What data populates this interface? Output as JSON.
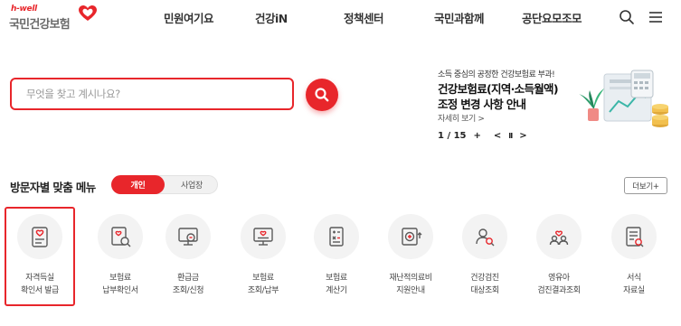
{
  "logo": {
    "brand_en": "h-well",
    "brand_ko": "국민건강보험"
  },
  "nav": [
    "민원여기요",
    "건강iN",
    "정책센터",
    "국민과함께",
    "공단요모조모"
  ],
  "header_icons": [
    "search-icon",
    "hamburger-menu-icon"
  ],
  "search": {
    "placeholder": "무엇을 찾고 계시나요?",
    "value": ""
  },
  "banner": {
    "subtitle": "소득 중심의 공정한 건강보험료 부과!",
    "title_line1": "건강보험료(지역·소득월액)",
    "title_line2": "조정 변경 사항 안내",
    "more": "자세히 보기 >",
    "pager": "1 / 15",
    "plus": "+",
    "prev": "<",
    "pause": "II",
    "next": ">"
  },
  "section": {
    "title": "방문자별 맞춤 메뉴",
    "toggle": {
      "active": "개인",
      "inactive": "사업장"
    },
    "more": "더보기+"
  },
  "menu_items": [
    {
      "line1": "자격득실",
      "line2": "확인서 발급",
      "icon": "id-card-heart-icon",
      "selected": true
    },
    {
      "line1": "보험료",
      "line2": "납부확인서",
      "icon": "document-search-icon",
      "selected": false
    },
    {
      "line1": "환급금",
      "line2": "조회/신청",
      "icon": "monitor-coin-icon",
      "selected": false
    },
    {
      "line1": "보험료",
      "line2": "조회/납부",
      "icon": "monitor-pay-icon",
      "selected": false
    },
    {
      "line1": "보험료",
      "line2": "계산기",
      "icon": "calculator-icon",
      "selected": false
    },
    {
      "line1": "재난적의료비",
      "line2": "지원안내",
      "icon": "medical-support-icon",
      "selected": false
    },
    {
      "line1": "건강검진",
      "line2": "대상조회",
      "icon": "user-search-icon",
      "selected": false
    },
    {
      "line1": "영유아",
      "line2": "검진결과조회",
      "icon": "family-heart-icon",
      "selected": false
    },
    {
      "line1": "서식",
      "line2": "자료실",
      "icon": "form-document-icon",
      "selected": false
    }
  ],
  "colors": {
    "accent": "#e8262b",
    "icon_gray": "#5a5a5a",
    "circle_bg": "#f3f3f3"
  }
}
